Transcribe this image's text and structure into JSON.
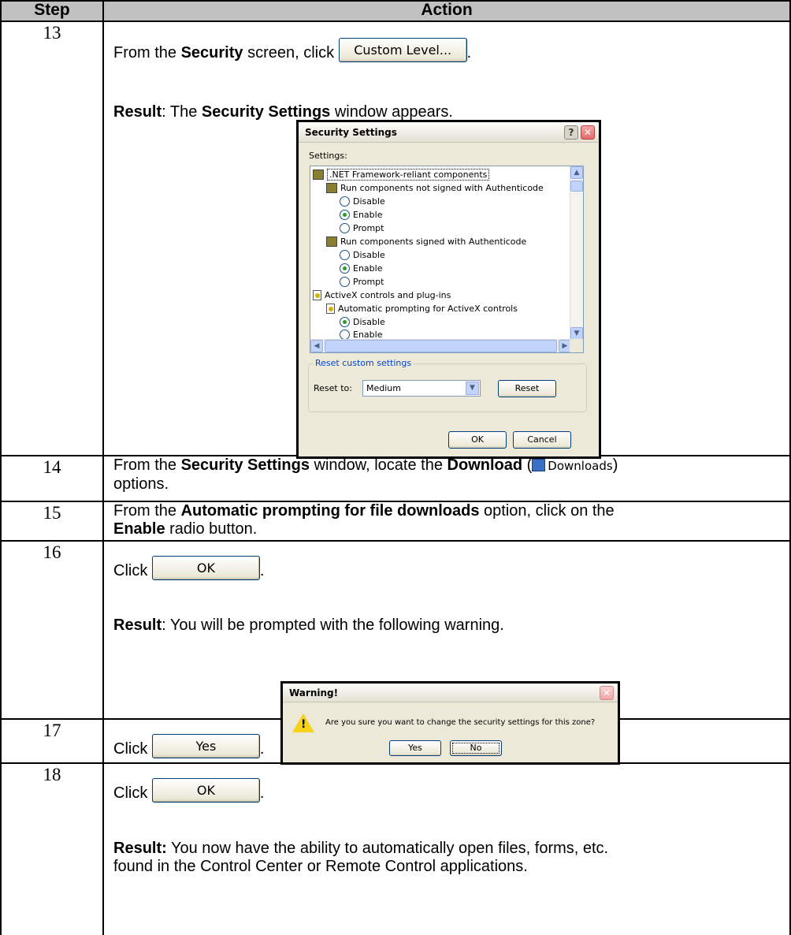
{
  "table": {
    "header_step": "Step",
    "header_action": "Action"
  },
  "steps": {
    "s13": {
      "number": "13",
      "pre": "From the ",
      "bold": "Security",
      "post": " screen, click ",
      "button_label": "Custom Level...",
      "end": ".",
      "result_label": "Result",
      "result_pre": ":  The ",
      "result_bold": "Security Settings",
      "result_post": " window appears."
    },
    "s14": {
      "number": "14",
      "pre": "From the ",
      "bold1": "Security Settings",
      "mid": " window, locate the ",
      "bold2": "Download",
      "paren_open": " (",
      "icon_text": "Downloads",
      "paren_close": ")",
      "line2": "options."
    },
    "s15": {
      "number": "15",
      "pre": "From the ",
      "bold1": "Automatic prompting for file downloads",
      "mid": " option, click on the",
      "bold2": "Enable",
      "post": " radio button."
    },
    "s16": {
      "number": "16",
      "click": "Click ",
      "button_label": "OK",
      "end": ".",
      "result_label": "Result",
      "result_text": ": You will be prompted with the following warning."
    },
    "s17": {
      "number": "17",
      "click": "Click ",
      "button_label": "Yes",
      "end": "."
    },
    "s18": {
      "number": "18",
      "click": "Click ",
      "button_label": "OK",
      "end": ".",
      "result_label": "Result:",
      "result_line1": "  You now have the ability to automatically open files, forms, etc.",
      "result_line2": "found in the Control Center or Remote Control applications."
    }
  },
  "security_dialog": {
    "title": "Security Settings",
    "help": "?",
    "close": "✕",
    "settings_label": "Settings:",
    "items": [
      {
        "text": ".NET Framework-reliant components"
      },
      {
        "text": "Run components not signed with Authenticode"
      },
      {
        "text": "Disable"
      },
      {
        "text": "Enable"
      },
      {
        "text": "Prompt"
      },
      {
        "text": "Run components signed with Authenticode"
      },
      {
        "text": "Disable"
      },
      {
        "text": "Enable"
      },
      {
        "text": "Prompt"
      },
      {
        "text": "ActiveX controls and plug-ins"
      },
      {
        "text": "Automatic prompting for ActiveX controls"
      },
      {
        "text": "Disable"
      },
      {
        "text": "Enable"
      }
    ],
    "scroll_up": "▲",
    "scroll_down": "▼",
    "scroll_left": "◀",
    "scroll_right": "▶",
    "fieldset_legend": "Reset custom settings",
    "reset_to_label": "Reset to:",
    "reset_to_value": "Medium",
    "dropdown_arrow": "▼",
    "reset_button": "Reset",
    "ok_button": "OK",
    "cancel_button": "Cancel"
  },
  "warning_dialog": {
    "title": "Warning!",
    "close": "✕",
    "mark": "!",
    "message": "Are you sure you want to change the security settings for this zone?",
    "yes_button": "Yes",
    "no_button": "No"
  }
}
